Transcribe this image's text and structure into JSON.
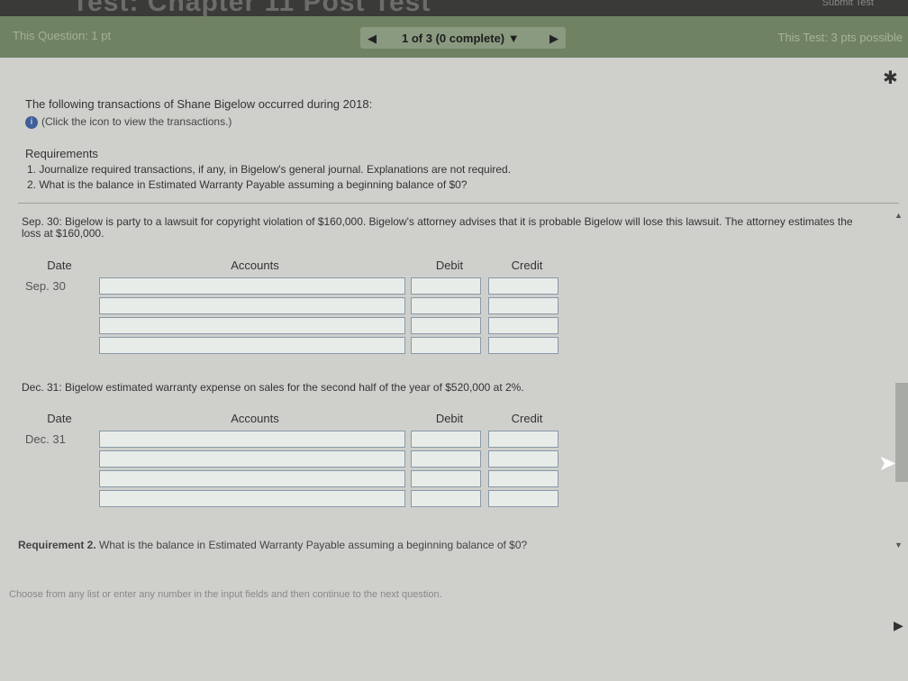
{
  "header": {
    "title": "Test: Chapter 11 Post Test",
    "submit_label": "Submit Test",
    "question_label": "This Question: 1 pt",
    "progress": "1 of 3 (0 complete)",
    "test_points": "This Test: 3 pts possible"
  },
  "body": {
    "intro": "The following transactions of Shane Bigelow occurred during 2018:",
    "info_link": "(Click the icon to view the transactions.)",
    "requirements_title": "Requirements",
    "req1": "1.  Journalize required transactions, if any, in Bigelow's general journal. Explanations are not required.",
    "req2": "2.  What is the balance in Estimated Warranty Payable assuming a beginning balance of $0?",
    "sep_text": "Sep. 30: Bigelow is party to a lawsuit for copyright violation of $160,000. Bigelow's attorney advises that it is probable Bigelow will lose this lawsuit. The attorney estimates the loss at $160,000.",
    "dec_text": "Dec. 31: Bigelow estimated warranty expense on sales for the second half of the year of $520,000 at 2%.",
    "requirement2_bold": "Requirement 2.",
    "requirement2_text": " What is the balance in Estimated Warranty Payable assuming a beginning balance of $0?",
    "choose_text": "Choose from any list or enter any number in the input fields and then continue to the next question."
  },
  "journal_headers": {
    "date": "Date",
    "accounts": "Accounts",
    "debit": "Debit",
    "credit": "Credit"
  },
  "journal1": {
    "date": "Sep. 30"
  },
  "journal2": {
    "date": "Dec. 31"
  }
}
